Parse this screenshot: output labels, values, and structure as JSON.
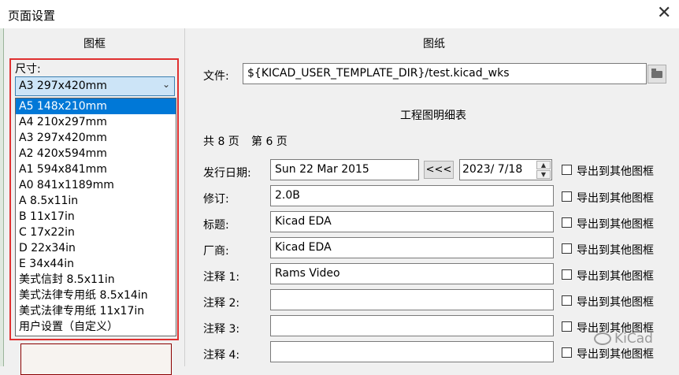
{
  "window": {
    "title": "页面设置",
    "close_glyph": "✕"
  },
  "frame_section": {
    "heading": "图框",
    "size_label": "尺寸:",
    "selected_size": "A3 297x420mm",
    "options": [
      "A5 148x210mm",
      "A4 210x297mm",
      "A3 297x420mm",
      "A2 420x594mm",
      "A1 594x841mm",
      "A0 841x1189mm",
      "A 8.5x11in",
      "B 11x17in",
      "C 17x22in",
      "D 22x34in",
      "E 34x44in",
      "美式信封 8.5x11in",
      "美式法律专用纸 8.5x14in",
      "美式法律专用纸 11x17in",
      "用户设置（自定义）"
    ],
    "highlighted_option": "A5 148x210mm"
  },
  "drawing_section": {
    "heading": "图纸",
    "file_label": "文件:",
    "file_value": "${KICAD_USER_TEMPLATE_DIR}/test.kicad_wks",
    "titleblock_heading": "工程图明细表",
    "page_count": "共 8 页",
    "page_number": "第 6 页",
    "issue_date_label": "发行日期:",
    "issue_date_value": "Sun 22 Mar 2015",
    "copy_date_button": "<<<",
    "date_picker_value": "2023/  7/18",
    "revision_label": "修订:",
    "revision_value": "2.0B",
    "title_label": "标题:",
    "title_value": "Kicad EDA",
    "company_label": "厂商:",
    "company_value": "Kicad EDA",
    "comment1_label": "注释 1:",
    "comment1_value": "Rams Video",
    "comment2_label": "注释 2:",
    "comment2_value": "",
    "comment3_label": "注释 3:",
    "comment3_value": "",
    "comment4_label": "注释 4:",
    "comment4_value": "",
    "export_label": "导出到其他图框"
  },
  "watermark": "KiCad"
}
